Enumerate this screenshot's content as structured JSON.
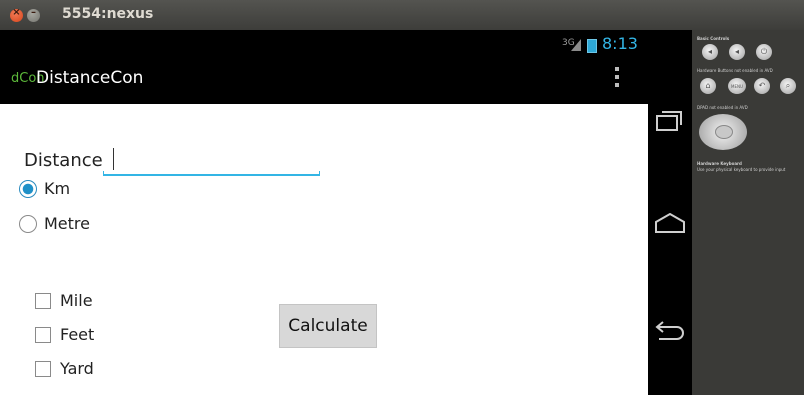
{
  "window": {
    "title": "5554:nexus"
  },
  "status_bar": {
    "signal": "3G",
    "time": "8:13"
  },
  "action_bar": {
    "logo": "dCon",
    "title": "DistanceCon"
  },
  "form": {
    "distance_label": "Distance",
    "distance_value": "",
    "units": [
      {
        "label": "Km",
        "selected": true
      },
      {
        "label": "Metre",
        "selected": false
      }
    ],
    "targets": [
      {
        "label": "Mile",
        "checked": false
      },
      {
        "label": "Feet",
        "checked": false
      },
      {
        "label": "Yard",
        "checked": false
      }
    ],
    "calculate_label": "Calculate"
  },
  "controls": {
    "basic_label": "Basic Controls",
    "hw_buttons_label": "Hardware Buttons not enabled in AVD",
    "menu_label": "MENU",
    "dpad_label": "DPAD not enabled in AVD",
    "keyboard_label": "Hardware Keyboard",
    "keyboard_hint": "Use your physical keyboard to provide input"
  }
}
